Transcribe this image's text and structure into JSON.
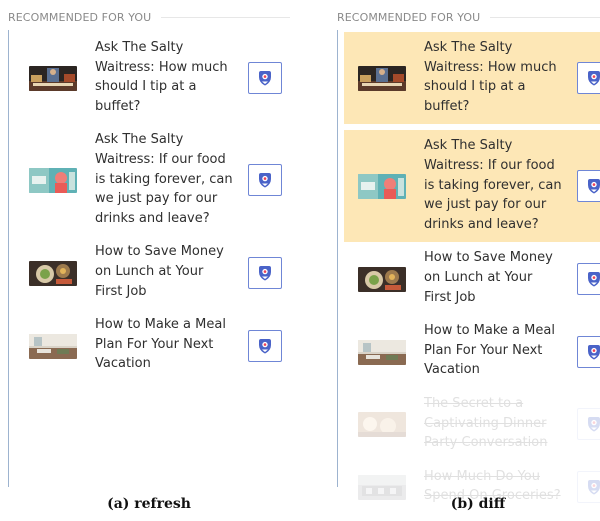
{
  "refresh_panel": {
    "section_title": "RECOMMENDED FOR YOU",
    "items": [
      {
        "title": "Ask The Salty Waitress: How much should I tip at a buffet?"
      },
      {
        "title": "Ask The Salty Waitress: If our food is taking forever, can we just pay for our drinks and leave?"
      },
      {
        "title": "How to Save Money on Lunch at Your First Job"
      },
      {
        "title": "How to Make a Meal Plan For Your Next Vacation"
      }
    ]
  },
  "diff_panel": {
    "section_title": "RECOMMENDED FOR YOU",
    "items": [
      {
        "title": "Ask The Salty Waitress: How much should I tip at a buffet?",
        "state": "added"
      },
      {
        "title": "Ask The Salty Waitress: If our food is taking forever, can we just pay for our drinks and leave?",
        "state": "added"
      },
      {
        "title": "How to Save Money on Lunch at Your First Job",
        "state": "unchanged"
      },
      {
        "title": "How to Make a Meal Plan For Your Next Vacation",
        "state": "unchanged"
      },
      {
        "title": "The Secret to a Captivating Dinner Party Conversation",
        "state": "removed"
      },
      {
        "title": "How Much Do You Spend On Groceries?",
        "state": "removed"
      }
    ]
  },
  "captions": {
    "a": "(a) refresh",
    "b": "(b) diff"
  },
  "colors": {
    "highlight": "#fde7b6",
    "pocket_icon": "#4a63c8",
    "pocket_accent": "#ee4056"
  }
}
